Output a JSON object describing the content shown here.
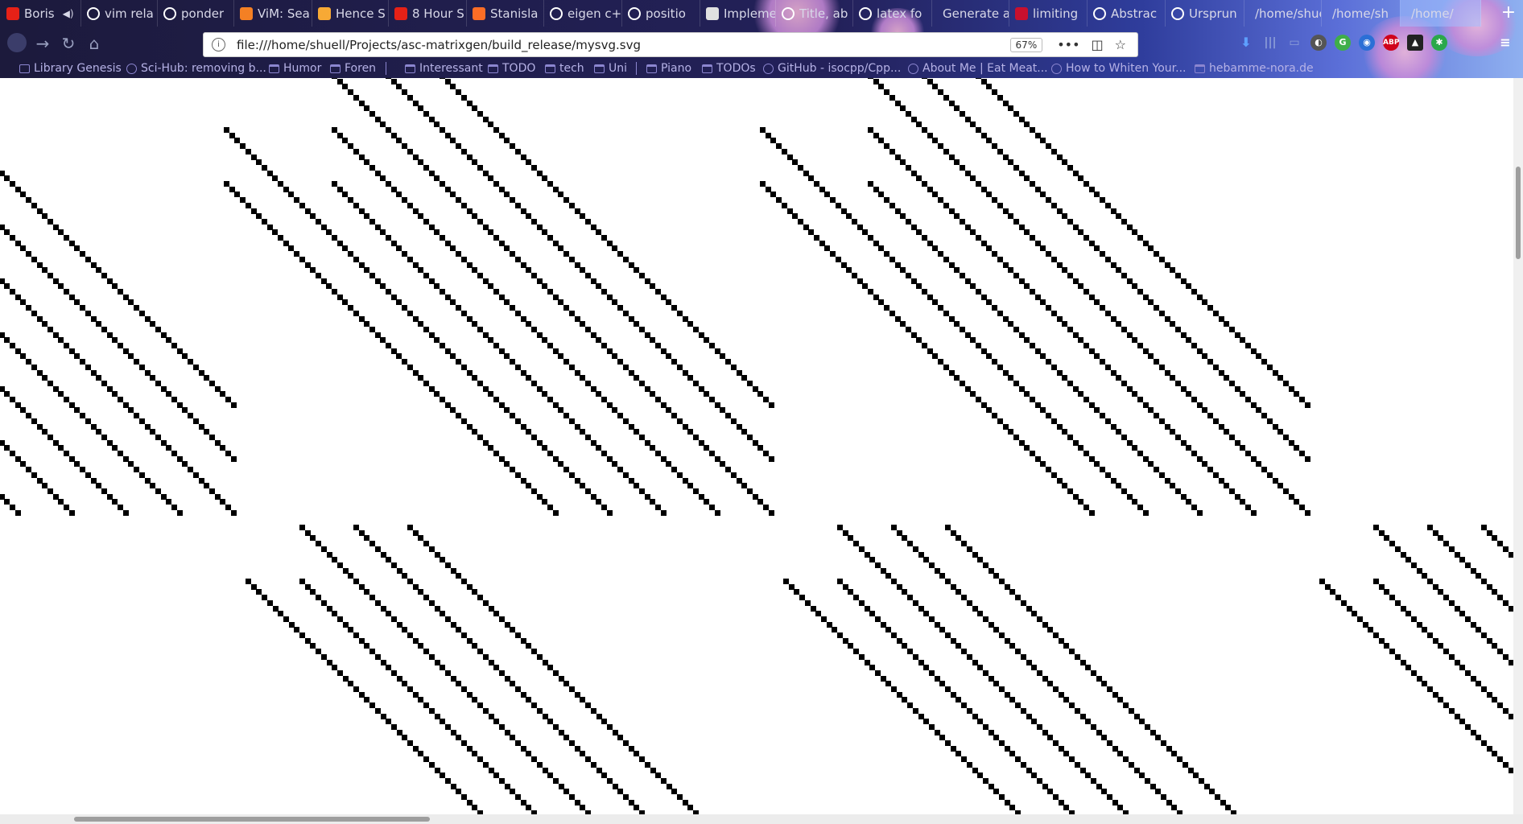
{
  "browser": {
    "tabs": [
      {
        "label": "Boris",
        "icon": "youtube-icon",
        "color": "#e62117",
        "muted_audio": true
      },
      {
        "label": "vim rela",
        "icon": "google-icon",
        "color": "#ffffff"
      },
      {
        "label": "ponder",
        "icon": "ics-icon",
        "color": "#ffffff"
      },
      {
        "label": "ViM: Sea",
        "icon": "stackoverflow-icon",
        "color": "#f48024"
      },
      {
        "label": "Hence S",
        "icon": "stackexchange-icon",
        "color": "#f7a935"
      },
      {
        "label": "8 Hour S",
        "icon": "youtube-icon",
        "color": "#e62117"
      },
      {
        "label": "Stanisla",
        "icon": "gitlab-icon",
        "color": "#fc6d26"
      },
      {
        "label": "eigen c+",
        "icon": "google-icon",
        "color": "#ffffff"
      },
      {
        "label": "positio",
        "icon": "ics-icon",
        "color": "#ffffff"
      },
      {
        "label": "Impleme",
        "icon": "page-icon",
        "color": "#e0e0e0"
      },
      {
        "label": "Title, ab",
        "icon": "tex-icon",
        "color": "#ffffff"
      },
      {
        "label": "latex fo",
        "icon": "google-icon",
        "color": "#ffffff"
      },
      {
        "label": "Generate a",
        "icon": "",
        "color": ""
      },
      {
        "label": "limiting",
        "icon": "ic-icon",
        "color": "#c8102e"
      },
      {
        "label": "Abstrac",
        "icon": "wikipedia-icon",
        "color": "#ffffff"
      },
      {
        "label": "Ursprun",
        "icon": "ics-icon",
        "color": "#ffffff"
      },
      {
        "label": "/home/shue",
        "icon": "",
        "color": ""
      },
      {
        "label": "/home/sh",
        "icon": "",
        "color": ""
      },
      {
        "label": "/home/",
        "icon": "",
        "color": "",
        "active": true
      }
    ],
    "new_tab_icon": "plus-icon",
    "nav": {
      "back_icon": "back-arrow-icon",
      "forward_icon": "forward-arrow-icon",
      "reload_icon": "reload-icon",
      "home_icon": "home-icon"
    },
    "url": "file:///home/shuell/Projects/asc-matrixgen/build_release/mysvg.svg",
    "zoom": "67%",
    "bookmarks": [
      {
        "label": "Library Genesis",
        "icon": "bookmark-icon"
      },
      {
        "label": "Sci-Hub: removing b...",
        "icon": "eye-icon"
      },
      {
        "label": "Humor",
        "icon": "folder-icon"
      },
      {
        "label": "Foren",
        "icon": "folder-icon"
      },
      {
        "label": "Interessant",
        "icon": "folder-icon"
      },
      {
        "label": "TODO",
        "icon": "folder-icon"
      },
      {
        "label": "tech",
        "icon": "folder-icon"
      },
      {
        "label": "Uni",
        "icon": "folder-icon"
      },
      {
        "label": "Piano",
        "icon": "folder-icon"
      },
      {
        "label": "TODOs",
        "icon": "folder-icon"
      },
      {
        "label": "GitHub - isocpp/Cpp...",
        "icon": "github-icon"
      },
      {
        "label": "About Me | Eat Meat...",
        "icon": "wordpress-icon"
      },
      {
        "label": "How to Whiten Your...",
        "icon": "globe-icon"
      },
      {
        "label": "hebamme-nora.de",
        "icon": "folder-icon"
      }
    ]
  },
  "document": {
    "type": "svg",
    "content": "sparse matrix pattern of black square cells arranged in diagonal bands",
    "cell_color": "#000000",
    "background": "#ffffff"
  }
}
